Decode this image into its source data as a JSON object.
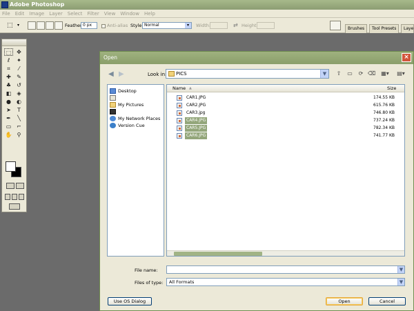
{
  "app": {
    "title": "Adobe Photoshop"
  },
  "menu": [
    "File",
    "Edit",
    "Image",
    "Layer",
    "Select",
    "Filter",
    "View",
    "Window",
    "Help"
  ],
  "options_bar": {
    "feather_label": "Feather:",
    "feather_value": "0 px",
    "antialias_label": "Anti-alias",
    "style_label": "Style:",
    "style_value": "Normal",
    "width_label": "Width:",
    "height_label": "Height:",
    "tabs": [
      "Brushes",
      "Tool Presets",
      "Layers"
    ]
  },
  "dialog": {
    "title": "Open",
    "look_in_label": "Look in:",
    "look_in_value": "PICS",
    "places": [
      "Desktop",
      "My Pictures",
      "My Network Places",
      "Version Cue"
    ],
    "columns": {
      "name": "Name",
      "size": "Size"
    },
    "files": [
      {
        "name": "CAR1.JPG",
        "size": "174.55 KB",
        "selected": false
      },
      {
        "name": "CAR2.JPG",
        "size": "615.76 KB",
        "selected": false
      },
      {
        "name": "CAR3.jpg",
        "size": "746.80 KB",
        "selected": false
      },
      {
        "name": "CAR4.JPG",
        "size": "737.24 KB",
        "selected": true
      },
      {
        "name": "CAR5.JPG",
        "size": "782.34 KB",
        "selected": true
      },
      {
        "name": "CAR6.JPG",
        "size": "741.77 KB",
        "selected": true
      }
    ],
    "file_name_label": "File name:",
    "file_name_value": "",
    "files_of_type_label": "Files of type:",
    "files_of_type_value": "All Formats",
    "use_os_dialog_label": "Use OS Dialog",
    "open_label": "Open",
    "cancel_label": "Cancel"
  }
}
